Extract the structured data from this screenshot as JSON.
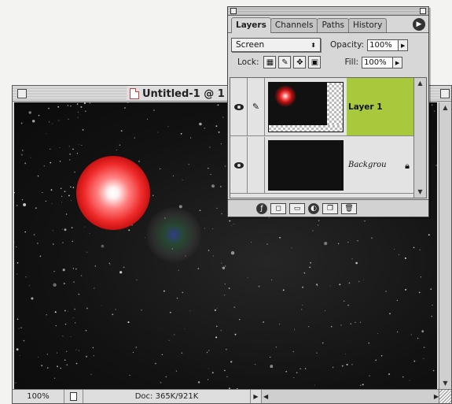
{
  "document": {
    "title": "Untitled-1 @ 1",
    "zoom": "100%",
    "doc_info": "Doc: 365K/921K"
  },
  "layers_palette": {
    "tabs": [
      "Layers",
      "Channels",
      "Paths",
      "History"
    ],
    "active_tab": "Layers",
    "blend_mode": "Screen",
    "opacity_label": "Opacity:",
    "opacity_value": "100%",
    "lock_label": "Lock:",
    "fill_label": "Fill:",
    "fill_value": "100%",
    "layers": [
      {
        "name": "Layer 1",
        "selected": true
      },
      {
        "name": "Backgrou",
        "selected": false,
        "locked": true
      }
    ],
    "layer_highlight_color": "#a9c93c"
  },
  "icons": {
    "eye": "eye-icon",
    "brush": "brush-icon",
    "lock": "lock-icon",
    "menu": "palette-menu-icon"
  }
}
